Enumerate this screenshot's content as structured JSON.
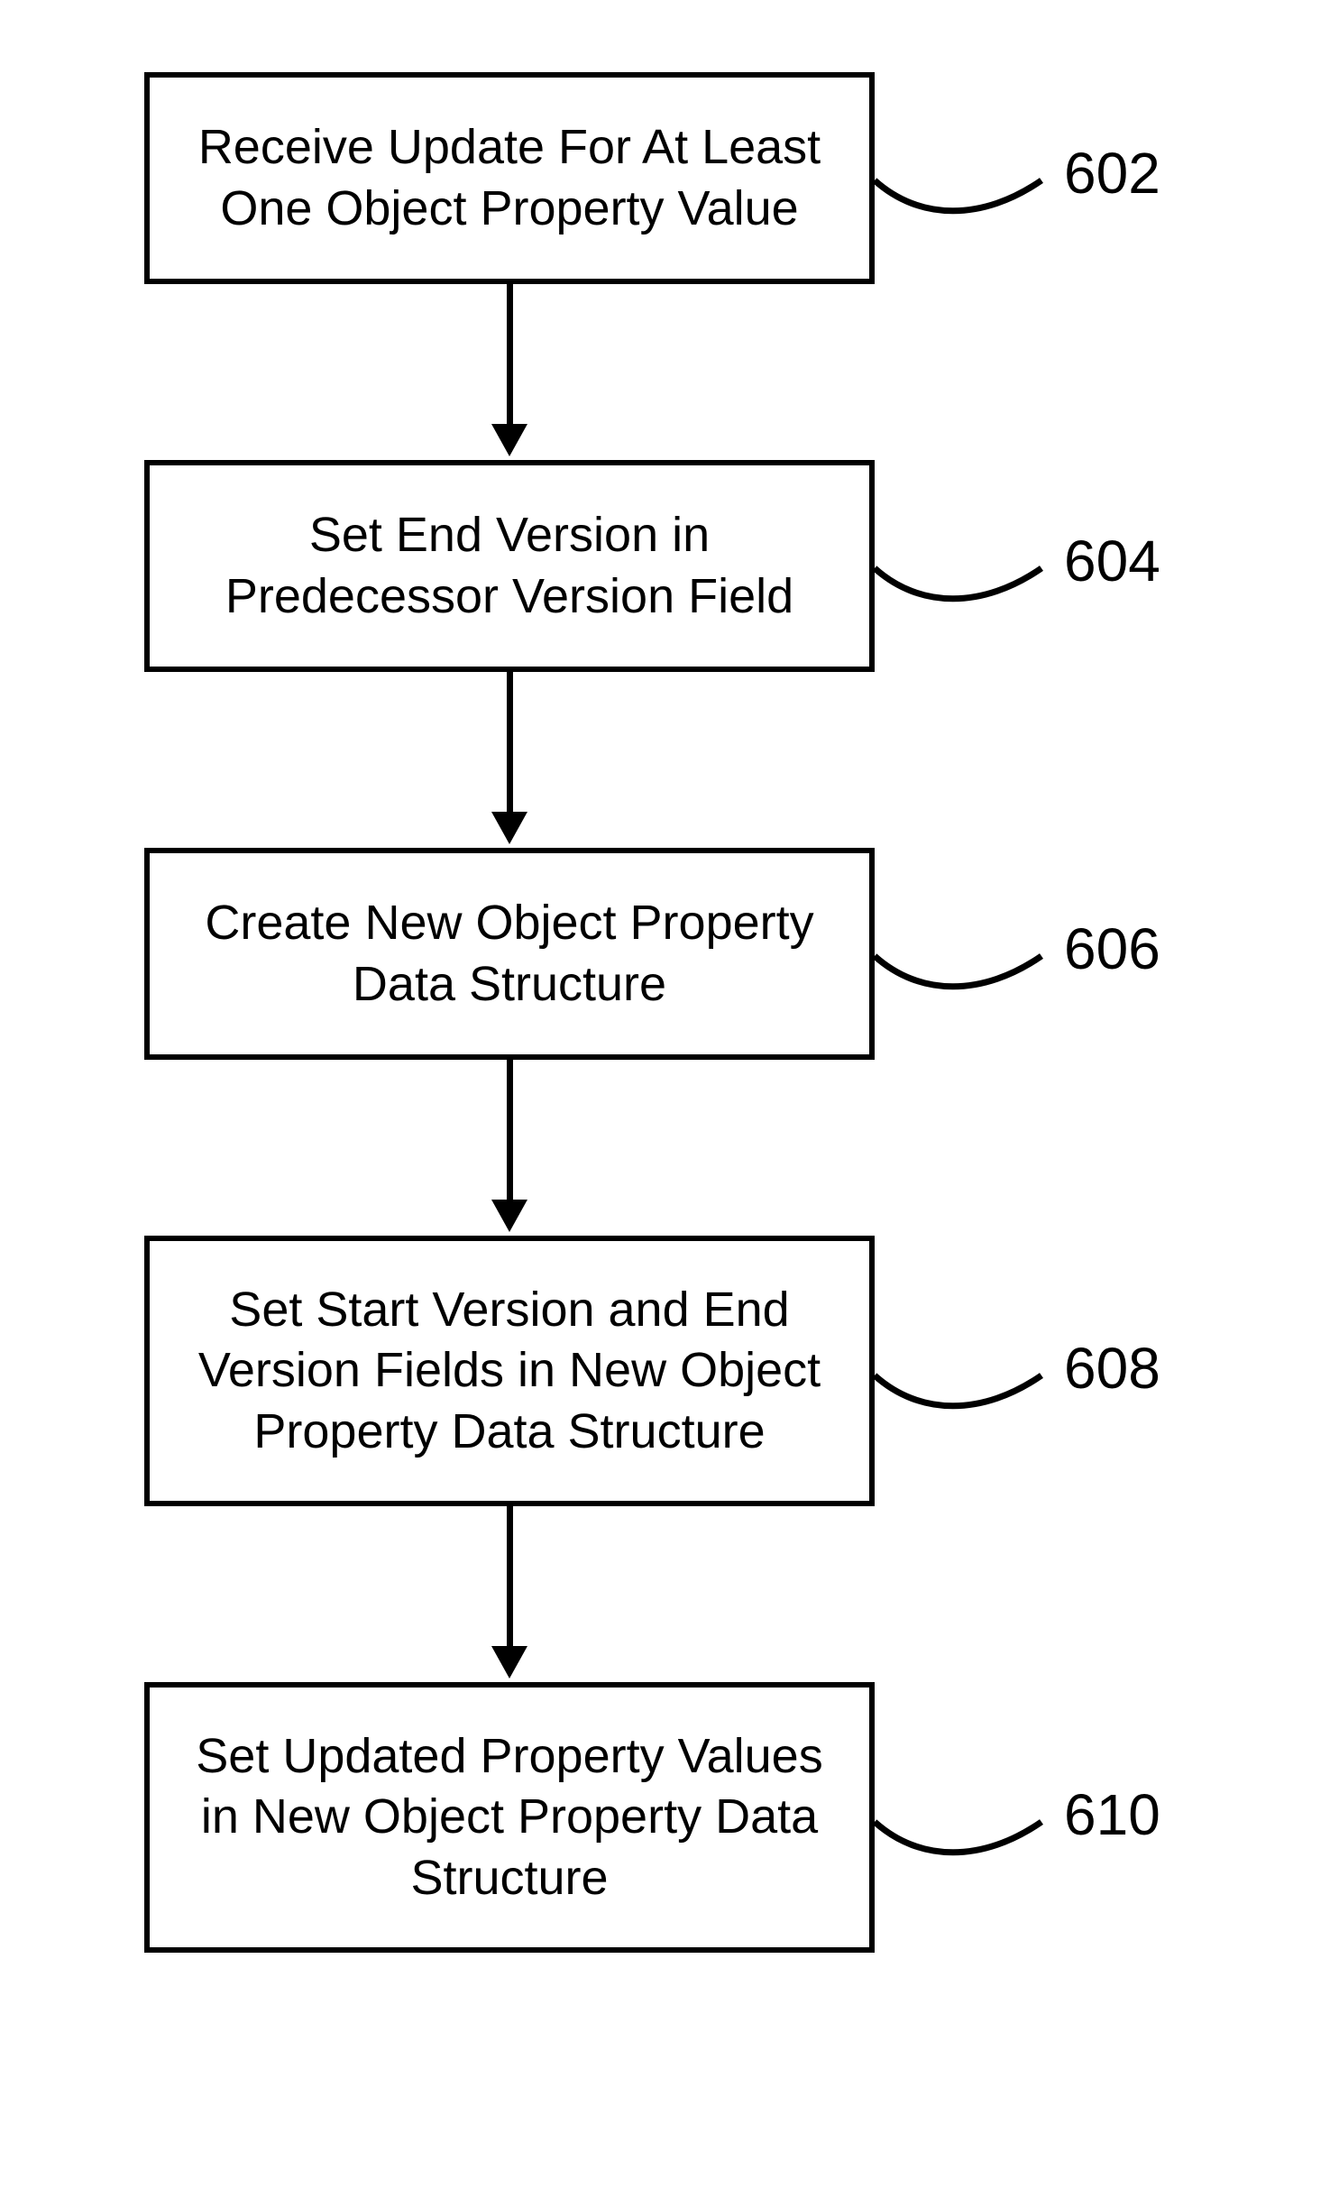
{
  "chart_data": {
    "type": "flowchart",
    "direction": "top-to-bottom",
    "nodes": [
      {
        "id": "602",
        "label": "Receive Update For At Least One Object Property Value"
      },
      {
        "id": "604",
        "label": "Set End Version in Predecessor Version Field"
      },
      {
        "id": "606",
        "label": "Create New Object Property Data Structure"
      },
      {
        "id": "608",
        "label": "Set Start Version and End Version Fields in New Object Property Data Structure"
      },
      {
        "id": "610",
        "label": "Set Updated Property Values in New Object Property Data Structure"
      }
    ],
    "edges": [
      {
        "from": "602",
        "to": "604"
      },
      {
        "from": "604",
        "to": "606"
      },
      {
        "from": "606",
        "to": "608"
      },
      {
        "from": "608",
        "to": "610"
      }
    ]
  },
  "boxes": {
    "b602": {
      "text": "Receive Update For At Least One Object Property Value",
      "ref": "602"
    },
    "b604": {
      "text": "Set End Version in Predecessor Version Field",
      "ref": "604"
    },
    "b606": {
      "text": "Create New Object Property Data Structure",
      "ref": "606"
    },
    "b608": {
      "text": "Set Start Version and End Version Fields in New Object Property Data Structure",
      "ref": "608"
    },
    "b610": {
      "text": "Set Updated Property Values in New Object Property Data Structure",
      "ref": "610"
    }
  }
}
